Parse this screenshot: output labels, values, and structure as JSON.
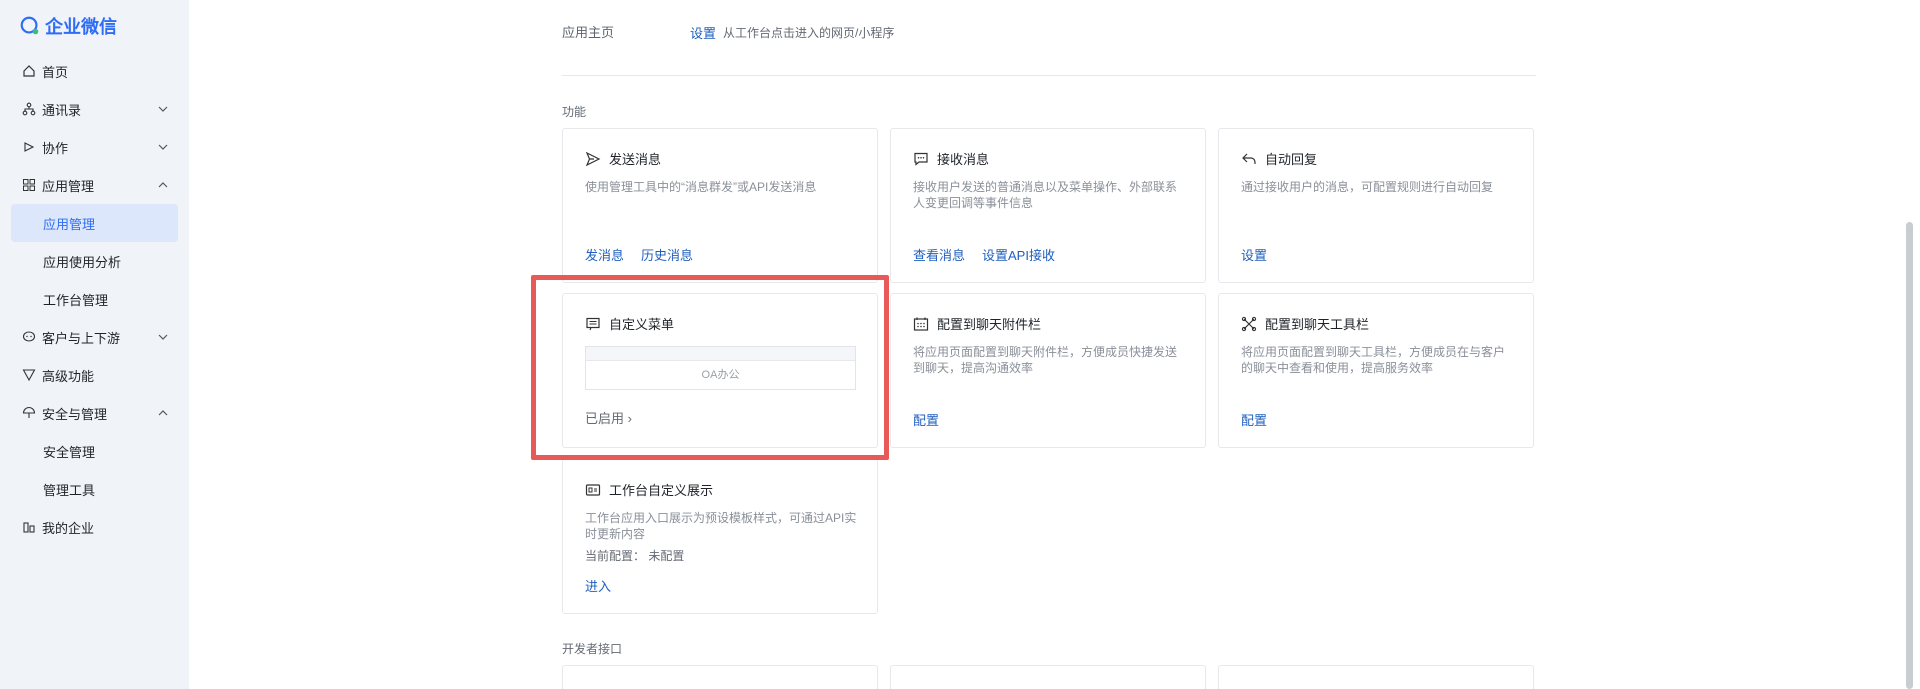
{
  "sidebar": {
    "logo": "企业微信",
    "items": [
      {
        "label": "首页",
        "icon": "home-icon"
      },
      {
        "label": "通讯录",
        "icon": "org-icon",
        "chevron": "down"
      },
      {
        "label": "协作",
        "icon": "collab-icon",
        "chevron": "down"
      },
      {
        "label": "应用管理",
        "icon": "apps-icon",
        "chevron": "up"
      },
      {
        "label": "应用管理",
        "sub": true,
        "active": true
      },
      {
        "label": "应用使用分析",
        "sub": true
      },
      {
        "label": "工作台管理",
        "sub": true
      },
      {
        "label": "客户与上下游",
        "icon": "chat-icon",
        "chevron": "down"
      },
      {
        "label": "高级功能",
        "icon": "filter-icon"
      },
      {
        "label": "安全与管理",
        "icon": "umbrella-icon",
        "chevron": "up"
      },
      {
        "label": "安全管理",
        "sub": true
      },
      {
        "label": "管理工具",
        "sub": true
      },
      {
        "label": "我的企业",
        "icon": "building-icon"
      }
    ]
  },
  "home_row": {
    "label": "应用主页",
    "action": "设置",
    "desc": "从工作台点击进入的网页/小程序"
  },
  "sections": {
    "features": "功能",
    "dev": "开发者接口"
  },
  "cards": {
    "send": {
      "title": "发送消息",
      "desc": "使用管理工具中的“消息群发”或API发送消息",
      "links": [
        "发消息",
        "历史消息"
      ]
    },
    "receive": {
      "title": "接收消息",
      "desc": "接收用户发送的普通消息以及菜单操作、外部联系人变更回调等事件信息",
      "links": [
        "查看消息",
        "设置API接收"
      ]
    },
    "reply": {
      "title": "自动回复",
      "desc": "通过接收用户的消息，可配置规则进行自动回复",
      "links": [
        "设置"
      ]
    },
    "menu": {
      "title": "自定义菜单",
      "preview_item": "OA办公",
      "status": "已启用 ›"
    },
    "attach": {
      "title": "配置到聊天附件栏",
      "desc": "将应用页面配置到聊天附件栏，方便成员快捷发送到聊天，提高沟通效率",
      "links": [
        "配置"
      ]
    },
    "toolbar": {
      "title": "配置到聊天工具栏",
      "desc": "将应用页面配置到聊天工具栏，方便成员在与客户的聊天中查看和使用，提高服务效率",
      "links": [
        "配置"
      ]
    },
    "workbench": {
      "title": "工作台自定义展示",
      "desc": "工作台应用入口展示为预设模板样式，可通过API实时更新内容",
      "config_label": "当前配置：",
      "config_value": "未配置",
      "links": [
        "进入"
      ]
    }
  },
  "colors": {
    "accent": "#2f6df6",
    "link": "#1f5fbf",
    "highlight": "#e85a57"
  }
}
